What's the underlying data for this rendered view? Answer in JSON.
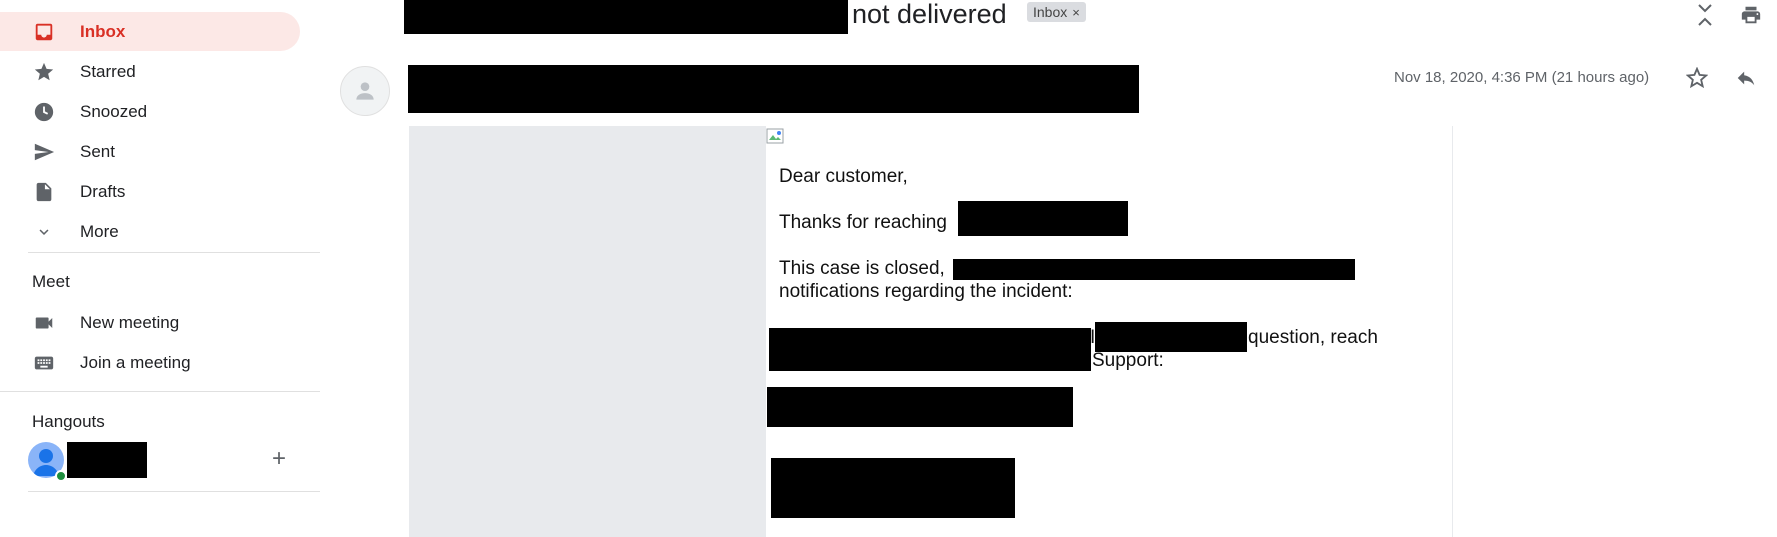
{
  "sidebar": {
    "items": [
      {
        "label": "Inbox",
        "icon": "inbox-icon"
      },
      {
        "label": "Starred",
        "icon": "star-icon"
      },
      {
        "label": "Snoozed",
        "icon": "clock-icon"
      },
      {
        "label": "Sent",
        "icon": "send-icon"
      },
      {
        "label": "Drafts",
        "icon": "draft-icon"
      },
      {
        "label": "More",
        "icon": "chevron-down-icon"
      }
    ],
    "meet": {
      "title": "Meet",
      "new_meeting": "New meeting",
      "join_meeting": "Join a meeting"
    },
    "hangouts": {
      "title": "Hangouts",
      "add_symbol": "+"
    }
  },
  "header": {
    "subject": "not delivered",
    "label_chip": "Inbox",
    "chip_close": "×"
  },
  "message": {
    "date": "Nov 18, 2020, 4:36 PM (21 hours ago)",
    "greeting": "Dear customer,",
    "thanks": "Thanks for reaching",
    "closed": "This case is closed,",
    "notifications": "notifications regarding the incident:",
    "question_fragment": "question, reach",
    "support": "Support:",
    "stray_char": "I"
  },
  "colors": {
    "accent": "#d93025",
    "active_bg": "#fce8e6",
    "icon_gray": "#5f6368",
    "body_bg": "#e8eaed"
  }
}
